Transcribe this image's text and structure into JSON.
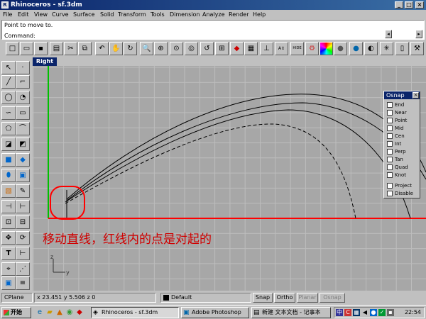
{
  "window": {
    "title": "Rhinoceros - sf.3dm"
  },
  "menu": [
    "File",
    "Edit",
    "View",
    "Curve",
    "Surface",
    "Solid",
    "Transform",
    "Tools",
    "Dimension",
    "Analyze",
    "Render",
    "Help"
  ],
  "command": {
    "history": "Point to move to.",
    "prompt": "Command:"
  },
  "viewport": {
    "name": "Right",
    "annotation": "移动直线，红线内的点是对起的",
    "axis_z": "z",
    "axis_y": "y",
    "colors": {
      "grid": "#bdbdbd",
      "background": "#a7a7a7",
      "x_axis": "#ff0000",
      "y_axis": "#00c000",
      "circle": "#ff0000",
      "annotation": "#d00000",
      "curves": "#000000"
    }
  },
  "osnap": {
    "title": "Osnap",
    "items": [
      "End",
      "Near",
      "Point",
      "Mid",
      "Cen",
      "Int",
      "Perp",
      "Tan",
      "Quad",
      "Knot"
    ],
    "extra": [
      "Project",
      "Disable"
    ]
  },
  "status": {
    "cplane": "CPlane",
    "coords": "x 23.451  y 5.506  z 0",
    "layer": "Default",
    "snap": "Snap",
    "ortho": "Ortho",
    "planar": "Planar",
    "osnap": "Osnap"
  },
  "taskbar": {
    "start": "开始",
    "tasks": [
      "Rhinoceros - sf.3dm",
      "Adobe Photoshop",
      "新建 文本文档 - 记事本"
    ],
    "clock": "22:54"
  }
}
